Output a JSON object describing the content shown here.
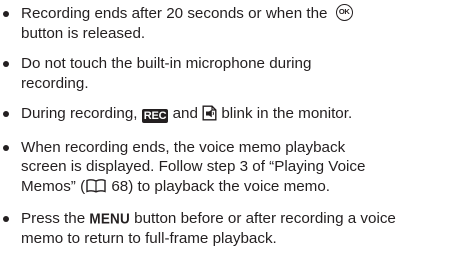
{
  "bullets": [
    {
      "line1_a": "Recording ends after 20 seconds or when the ",
      "ok_icon_label": "OK",
      "line2": "button is released."
    },
    {
      "line1": "Do not touch the built-in microphone during",
      "line2": "recording."
    },
    {
      "a": "During recording, ",
      "rec_icon_label": "REC",
      "b": " and ",
      "c": " blink in the monitor."
    },
    {
      "line1": "When recording ends, the voice memo playback",
      "line2": "screen is displayed. Follow step 3 of “Playing Voice",
      "line3_a": "Memos” (",
      "line3_page": " 68",
      "line3_b": ") to playback the voice memo."
    },
    {
      "a": "Press the ",
      "menu_label": "MENU",
      "b": " button before or after recording a voice",
      "line2": "memo to return to full-frame playback."
    }
  ],
  "icons": {
    "ok": "ok-button-icon",
    "rec": "rec-indicator-icon",
    "memo": "voice-memo-icon",
    "book": "page-reference-book-icon"
  },
  "colors": {
    "text": "#231f20",
    "background": "#ffffff"
  }
}
